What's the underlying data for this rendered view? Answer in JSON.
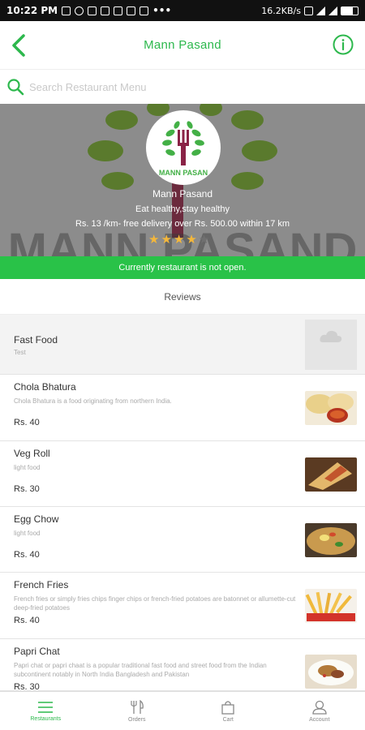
{
  "status_bar": {
    "time": "10:22 PM",
    "net_speed": "16.2KB/s"
  },
  "app_bar": {
    "title": "Mann Pasand",
    "back_icon": "chevron-left-icon",
    "info_icon": "info-icon"
  },
  "search": {
    "placeholder": "Search Restaurant Menu",
    "value": ""
  },
  "restaurant": {
    "logo_text": "MANN PASAN",
    "name": "Mann Pasand",
    "tagline": "Eat healthy,stay healthy",
    "delivery": "Rs.  13 /km- free delivery over Rs.  500.00 within 17 km",
    "rating": 4,
    "rating_max": 5,
    "watermark_text": "MANN PASAND"
  },
  "banner": {
    "closed_text": "Currently restaurant is not open."
  },
  "reviews_label": "Reviews",
  "category": {
    "name": "Fast Food",
    "desc": "Test"
  },
  "menu_items": [
    {
      "name": "Chola Bhatura",
      "desc": "Chola Bhatura is a food originating from northern India.",
      "price": "Rs. 40"
    },
    {
      "name": "Veg Roll",
      "desc": "light food",
      "price": "Rs. 30"
    },
    {
      "name": "Egg Chow",
      "desc": "light food",
      "price": "Rs. 40"
    },
    {
      "name": "French Fries",
      "desc": "French fries or simply fries chips finger chips or french-fried potatoes are batonnet or allumette-cut deep-fried potatoes",
      "price": "Rs. 40"
    },
    {
      "name": "Papri Chat",
      "desc": "Papri chat or papri chaat is a popular traditional fast food and street food from the Indian subcontinent notably in North India Bangladesh and Pakistan",
      "price": "Rs. 30"
    }
  ],
  "bottom_nav": [
    {
      "label": "Restaurants",
      "icon": "list-icon",
      "active": true
    },
    {
      "label": "Orders",
      "icon": "fork-knife-icon",
      "active": false
    },
    {
      "label": "Cart",
      "icon": "shopping-bag-icon",
      "active": false
    },
    {
      "label": "Account",
      "icon": "person-icon",
      "active": false
    }
  ],
  "colors": {
    "accent": "#2db84d",
    "banner": "#29c248",
    "star": "#f4b73b"
  }
}
